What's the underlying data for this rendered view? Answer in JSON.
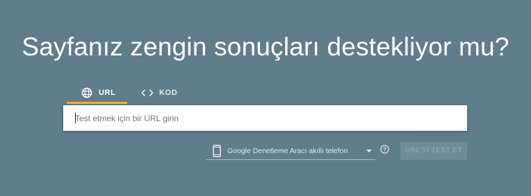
{
  "headline": "Sayfanız zengin sonuçları destekliyor mu?",
  "tabs": [
    {
      "label": "URL",
      "icon": "globe-icon",
      "active": true
    },
    {
      "label": "KOD",
      "icon": "code-icon",
      "active": false
    }
  ],
  "url_input": {
    "placeholder": "Test etmek için bir URL girin",
    "value": ""
  },
  "device_select": {
    "icon": "smartphone-icon",
    "selected": "Google Denetleme Aracı akıllı telefon"
  },
  "help": {
    "icon": "help-circle-icon"
  },
  "test_button": {
    "label": "URL'Yİ TEST ET",
    "enabled": false
  },
  "colors": {
    "background": "#607d8b",
    "active_tab_underline": "#f6ae2d",
    "button_disabled": "#6f8b98"
  }
}
